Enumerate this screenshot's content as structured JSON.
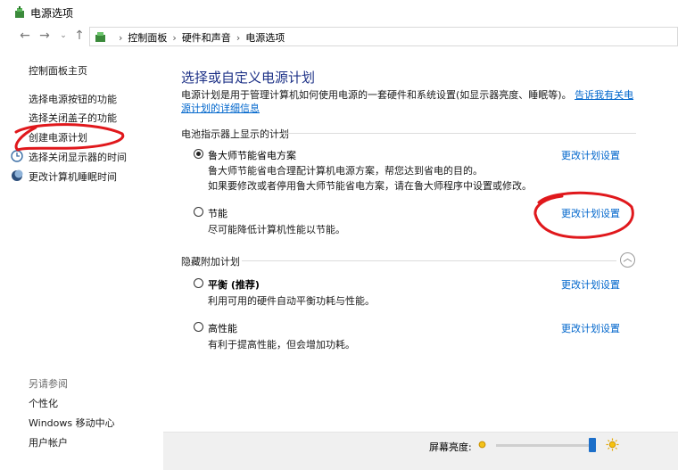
{
  "window": {
    "title": "电源选项"
  },
  "breadcrumbs": [
    "控制面板",
    "硬件和声音",
    "电源选项"
  ],
  "left_pane": {
    "home_link": "控制面板主页",
    "links": [
      "选择电源按钮的功能",
      "选择关闭盖子的功能",
      "创建电源计划",
      "选择关闭显示器的时间",
      "更改计算机睡眠时间"
    ],
    "see_also_title": "另请参阅",
    "see_also": [
      "个性化",
      "Windows 移动中心",
      "用户帐户"
    ]
  },
  "main": {
    "title": "选择或自定义电源计划",
    "intro": "电源计划是用于管理计算机如何使用电源的一套硬件和系统设置(如显示器亮度、睡眠等)。",
    "intro_link": "告诉我有关电源计划的详细信息",
    "battery_group": "电池指示器上显示的计划",
    "hidden_group": "隐藏附加计划",
    "change_label": "更改计划设置",
    "plans": [
      {
        "name": "鲁大师节能省电方案",
        "desc1": "鲁大师节能省电合理配计算机电源方案，帮您达到省电的目的。",
        "desc2": "如果要修改或者停用鲁大师节能省电方案，请在鲁大师程序中设置或修改。",
        "selected": true
      },
      {
        "name": "节能",
        "desc1": "尽可能降低计算机性能以节能。",
        "selected": false
      },
      {
        "name": "平衡 (推荐)",
        "desc1": "利用可用的硬件自动平衡功耗与性能。",
        "selected": false
      },
      {
        "name": "高性能",
        "desc1": "有利于提高性能，但会增加功耗。",
        "selected": false
      }
    ]
  },
  "brightness": {
    "label": "屏幕亮度:",
    "level": 0.98
  },
  "colors": {
    "link": "#0066cc",
    "title": "#1e3287",
    "annotation": "#e0181c"
  },
  "icons": [
    "power-options-icon",
    "back-arrow-icon",
    "forward-arrow-icon",
    "recent-chevron-icon",
    "up-arrow-icon",
    "control-panel-icon",
    "clock-icon",
    "moon-icon",
    "sun-dim-icon",
    "sun-bright-icon"
  ]
}
